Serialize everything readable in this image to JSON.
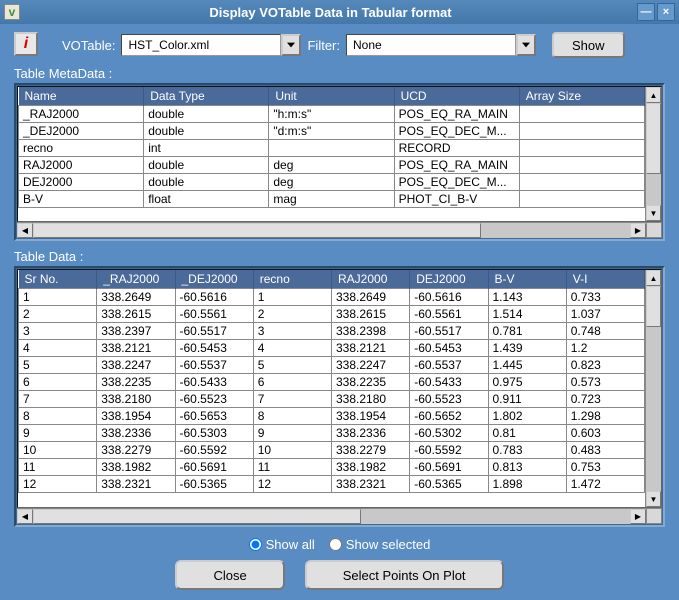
{
  "window": {
    "title": "Display VOTable Data in Tabular format",
    "app_icon_letter": "v"
  },
  "titlebar_buttons": {
    "minimize": "—",
    "close": "×"
  },
  "info_button": "i",
  "votable": {
    "label": "VOTable:",
    "value": "HST_Color.xml"
  },
  "filter": {
    "label": "Filter:",
    "value": "None"
  },
  "show_button": "Show",
  "metadata_section_label": "Table MetaData :",
  "meta_columns": [
    "Name",
    "Data Type",
    "Unit",
    "UCD",
    "Array Size"
  ],
  "meta_rows": [
    {
      "name": "_RAJ2000",
      "type": "double",
      "unit": "\"h:m:s\"",
      "ucd": "POS_EQ_RA_MAIN",
      "arr": ""
    },
    {
      "name": "_DEJ2000",
      "type": "double",
      "unit": "\"d:m:s\"",
      "ucd": "POS_EQ_DEC_M...",
      "arr": ""
    },
    {
      "name": "recno",
      "type": "int",
      "unit": "",
      "ucd": "RECORD",
      "arr": ""
    },
    {
      "name": "RAJ2000",
      "type": "double",
      "unit": "deg",
      "ucd": "POS_EQ_RA_MAIN",
      "arr": ""
    },
    {
      "name": "DEJ2000",
      "type": "double",
      "unit": "deg",
      "ucd": "POS_EQ_DEC_M...",
      "arr": ""
    },
    {
      "name": "B-V",
      "type": "float",
      "unit": "mag",
      "ucd": "PHOT_CI_B-V",
      "arr": ""
    }
  ],
  "data_section_label": "Table Data :",
  "data_columns": [
    "Sr No.",
    "_RAJ2000",
    "_DEJ2000",
    "recno",
    "RAJ2000",
    "DEJ2000",
    "B-V",
    "V-I"
  ],
  "data_rows": [
    [
      "1",
      "338.2649",
      "-60.5616",
      "1",
      "338.2649",
      "-60.5616",
      "1.143",
      "0.733"
    ],
    [
      "2",
      "338.2615",
      "-60.5561",
      "2",
      "338.2615",
      "-60.5561",
      "1.514",
      "1.037"
    ],
    [
      "3",
      "338.2397",
      "-60.5517",
      "3",
      "338.2398",
      "-60.5517",
      "0.781",
      "0.748"
    ],
    [
      "4",
      "338.2121",
      "-60.5453",
      "4",
      "338.2121",
      "-60.5453",
      "1.439",
      "1.2"
    ],
    [
      "5",
      "338.2247",
      "-60.5537",
      "5",
      "338.2247",
      "-60.5537",
      "1.445",
      "0.823"
    ],
    [
      "6",
      "338.2235",
      "-60.5433",
      "6",
      "338.2235",
      "-60.5433",
      "0.975",
      "0.573"
    ],
    [
      "7",
      "338.2180",
      "-60.5523",
      "7",
      "338.2180",
      "-60.5523",
      "0.911",
      "0.723"
    ],
    [
      "8",
      "338.1954",
      "-60.5653",
      "8",
      "338.1954",
      "-60.5652",
      "1.802",
      "1.298"
    ],
    [
      "9",
      "338.2336",
      "-60.5303",
      "9",
      "338.2336",
      "-60.5302",
      "0.81",
      "0.603"
    ],
    [
      "10",
      "338.2279",
      "-60.5592",
      "10",
      "338.2279",
      "-60.5592",
      "0.783",
      "0.483"
    ],
    [
      "11",
      "338.1982",
      "-60.5691",
      "11",
      "338.1982",
      "-60.5691",
      "0.813",
      "0.753"
    ],
    [
      "12",
      "338.2321",
      "-60.5365",
      "12",
      "338.2321",
      "-60.5365",
      "1.898",
      "1.472"
    ]
  ],
  "radio": {
    "show_all": "Show all",
    "show_selected": "Show selected",
    "selected": "all"
  },
  "buttons": {
    "close": "Close",
    "select_points": "Select Points On Plot"
  }
}
